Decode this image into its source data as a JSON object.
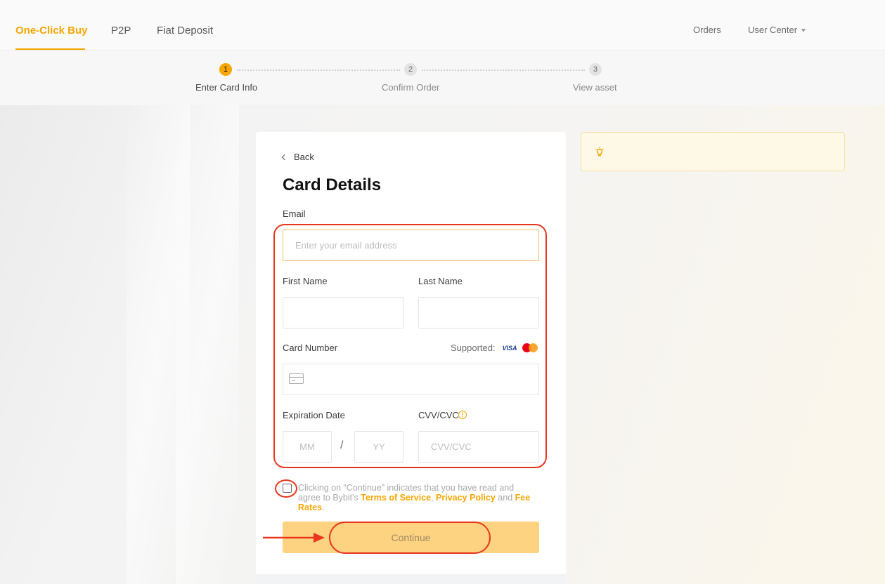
{
  "nav": {
    "items": [
      "One-Click Buy",
      "P2P",
      "Fiat Deposit"
    ],
    "active": "One-Click Buy",
    "orders": "Orders",
    "user_center": "User Center"
  },
  "stepper": {
    "steps": [
      {
        "num": "1",
        "label": "Enter Card Info",
        "active": true
      },
      {
        "num": "2",
        "label": "Confirm Order",
        "active": false
      },
      {
        "num": "3",
        "label": "View asset",
        "active": false
      }
    ]
  },
  "form": {
    "back": "Back",
    "title": "Card Details",
    "email_label": "Email",
    "email_placeholder": "Enter your email address",
    "first_name_label": "First Name",
    "last_name_label": "Last Name",
    "card_number_label": "Card Number",
    "supported_label": "Supported:",
    "visa": "VISA",
    "expiration_label": "Expiration Date",
    "mm_placeholder": "MM",
    "slash": "/",
    "yy_placeholder": "YY",
    "cvv_label": "CVV/CVC",
    "cvv_placeholder": "CVV/CVC",
    "terms": {
      "prefix": "Clicking on “Continue” indicates that you have read and agree to Bybit's ",
      "terms_link": "Terms of Service",
      "comma": ", ",
      "privacy_link": "Privacy Policy",
      "and": " and ",
      "fee_link": "Fee Rates",
      "period": "."
    },
    "continue": "Continue"
  },
  "colors": {
    "accent": "#f7a600",
    "button_disabled": "#fdd382",
    "annotation": "#e8371e"
  },
  "icons": {
    "back": "chevron-left-icon",
    "card": "credit-card-icon",
    "info": "info-icon",
    "tip": "lightbulb-icon",
    "caret": "caret-down-icon"
  }
}
